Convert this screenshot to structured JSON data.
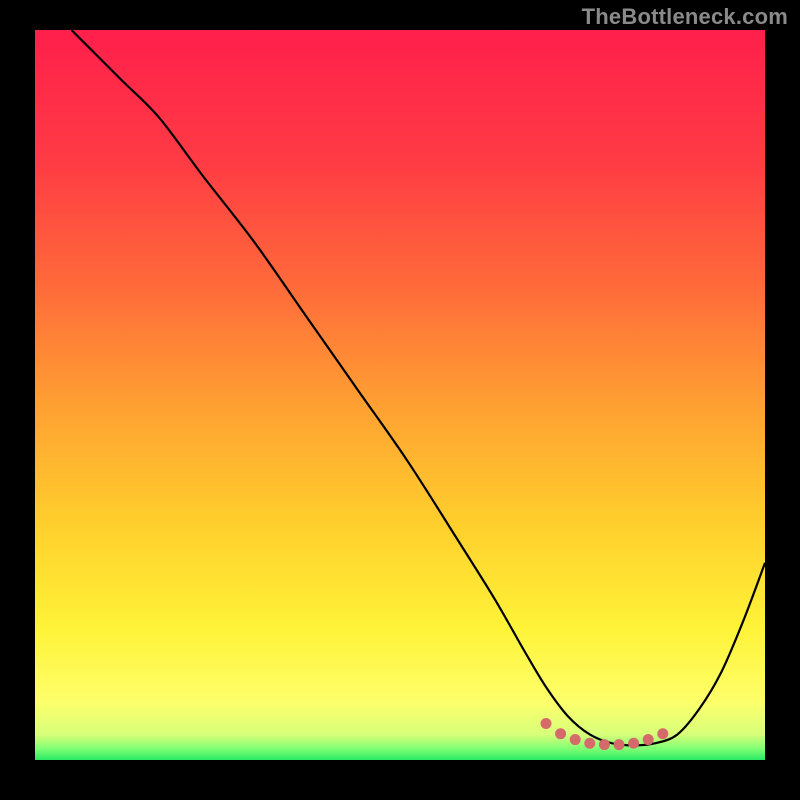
{
  "watermark": "TheBottleneck.com",
  "gradient": {
    "stops": [
      {
        "offset": 0.0,
        "color": "#ff1f4b"
      },
      {
        "offset": 0.18,
        "color": "#ff3b44"
      },
      {
        "offset": 0.35,
        "color": "#ff6a3a"
      },
      {
        "offset": 0.52,
        "color": "#ffa232"
      },
      {
        "offset": 0.68,
        "color": "#ffd02c"
      },
      {
        "offset": 0.82,
        "color": "#fff338"
      },
      {
        "offset": 0.92,
        "color": "#fdff6a"
      },
      {
        "offset": 0.965,
        "color": "#d8ff7a"
      },
      {
        "offset": 0.985,
        "color": "#7dff74"
      },
      {
        "offset": 1.0,
        "color": "#28e865"
      }
    ]
  },
  "chart_data": {
    "type": "line",
    "title": "",
    "xlabel": "",
    "ylabel": "",
    "xlim": [
      0,
      100
    ],
    "ylim": [
      0,
      100
    ],
    "series": [
      {
        "name": "curve",
        "x": [
          5,
          8,
          12,
          17,
          23,
          30,
          37,
          44,
          51,
          58,
          63,
          67,
          70,
          73,
          76,
          79,
          82,
          85,
          88,
          91,
          94,
          97,
          100
        ],
        "y": [
          100,
          97,
          93,
          88,
          80,
          71,
          61,
          51,
          41,
          30,
          22,
          15,
          10,
          6,
          3.5,
          2.3,
          2.0,
          2.3,
          3.5,
          7,
          12,
          19,
          27
        ]
      }
    ],
    "flat_markers": {
      "name": "flat-region",
      "color": "#d46a6a",
      "x": [
        70,
        72,
        74,
        76,
        78,
        80,
        82,
        84,
        86
      ],
      "y": [
        5.0,
        3.6,
        2.8,
        2.3,
        2.1,
        2.1,
        2.3,
        2.8,
        3.6
      ]
    }
  }
}
